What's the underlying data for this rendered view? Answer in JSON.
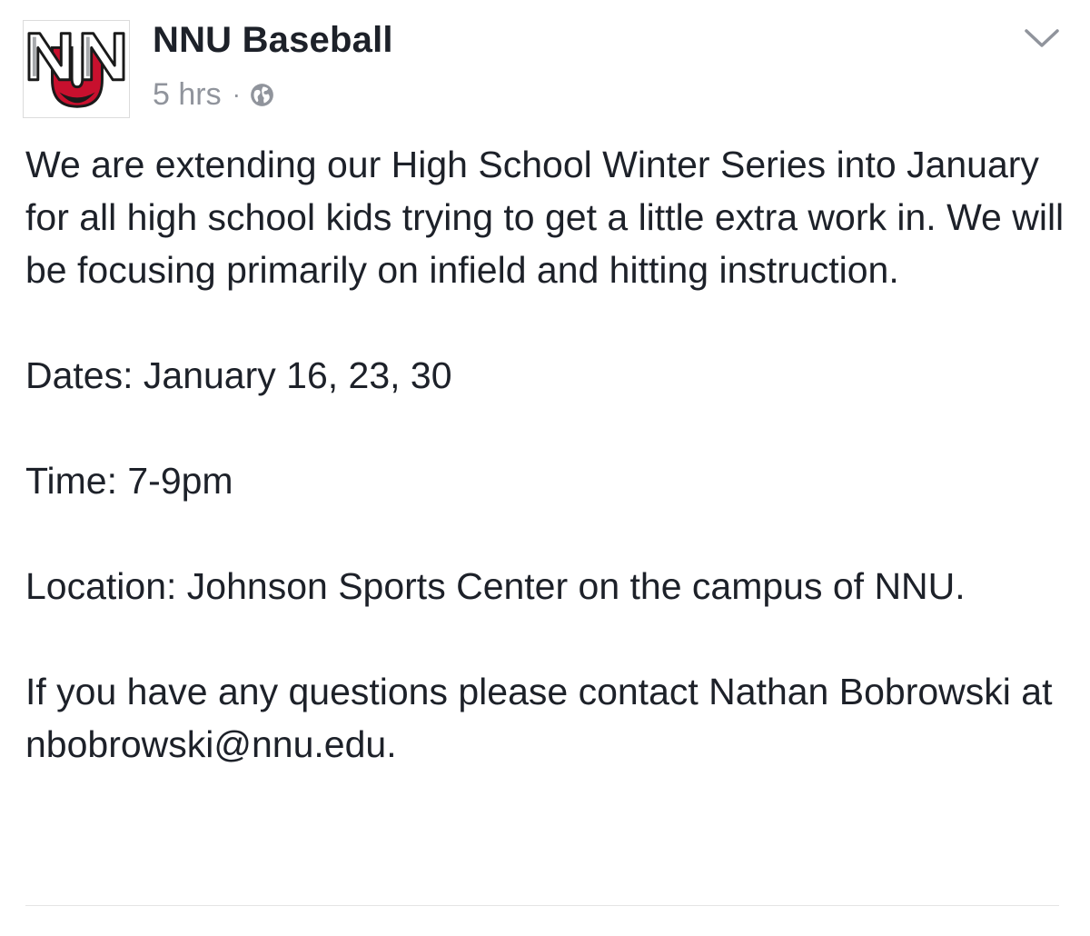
{
  "post": {
    "page_name": "NNU Baseball",
    "timestamp": "5 hrs",
    "separator": "·",
    "privacy_icon": "globe-icon",
    "menu_icon": "chevron-down-icon",
    "avatar": {
      "logo_text": "NNU",
      "colors": {
        "red": "#c8102e",
        "black": "#1a1a1a",
        "silver": "#a7a9ac"
      }
    },
    "paragraphs": [
      "We are extending our High School Winter Series into January for all high school kids trying to get a little extra work in. We will be focusing primarily on infield and hitting instruction.",
      "Dates: January 16, 23, 30",
      "Time: 7-9pm",
      "Location: Johnson Sports Center on the campus of NNU.",
      "If you have any questions please contact Nathan Bobrowski at nbobrowski@nnu.edu."
    ]
  },
  "colors": {
    "text": "#1d2129",
    "meta": "#90949c",
    "divider": "#e5e5e5"
  }
}
